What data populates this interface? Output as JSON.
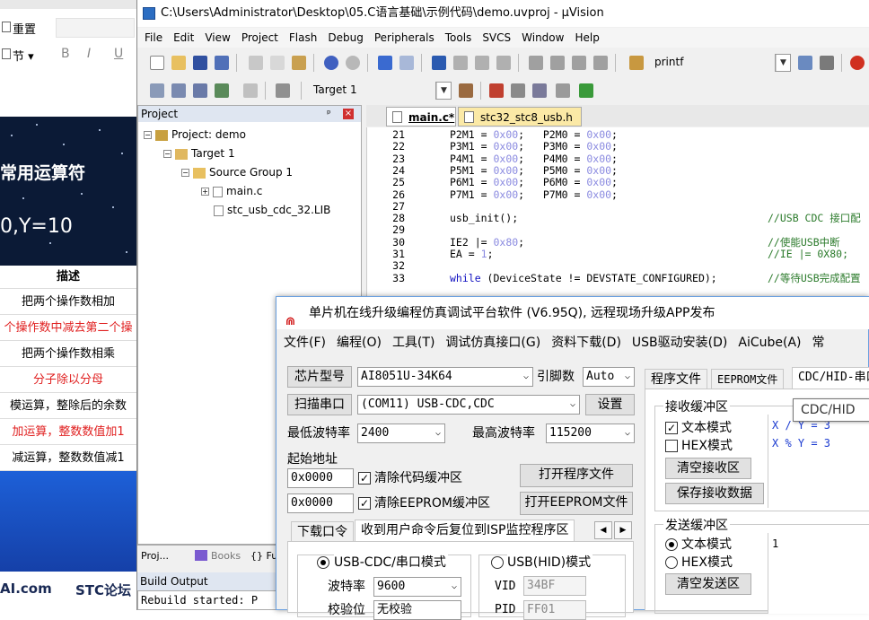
{
  "doc": {
    "toolbar_reset": "重置",
    "toolbar_section": "节 ▾",
    "toolbar_bold": "B",
    "toolbar_italic": "I",
    "toolbar_underline": "U",
    "title": "常用运算符",
    "formula": "0,Y=10",
    "table_header": "描述",
    "rows": [
      {
        "text": "把两个操作数相加",
        "red": false
      },
      {
        "text": "个操作数中减去第二个操",
        "red": true
      },
      {
        "text": "把两个操作数相乘",
        "red": false
      },
      {
        "text": "分子除以分母",
        "red": true
      },
      {
        "text": "模运算，整除后的余数",
        "red": false
      },
      {
        "text": "加运算，整数数值加1",
        "red": true
      },
      {
        "text": "减运算，整数数值减1",
        "red": false
      }
    ],
    "footer_left": "AI.com",
    "footer_right": "STC论坛"
  },
  "uv": {
    "title": "C:\\Users\\Administrator\\Desktop\\05.C语言基础\\示例代码\\demo.uvproj - µVision",
    "menu": [
      "File",
      "Edit",
      "View",
      "Project",
      "Flash",
      "Debug",
      "Peripherals",
      "Tools",
      "SVCS",
      "Window",
      "Help"
    ],
    "find_combo": "printf",
    "target_combo": "Target 1",
    "project_pane_title": "Project",
    "tree": {
      "project": "Project: demo",
      "target": "Target 1",
      "group": "Source Group 1",
      "file1": "main.c",
      "file2": "stc_usb_cdc_32.LIB"
    },
    "pane_tabs": [
      "Proj...",
      "Books",
      "{} Fu"
    ],
    "build_output_title": "Build Output",
    "build_text": "Rebuild started: P",
    "editor_tabs": [
      "main.c*",
      "stc32_stc8_usb.h"
    ],
    "code_lines": [
      {
        "n": "21",
        "code": "P2M1 = 0x00;   P2M0 = 0x00;",
        "comment": ""
      },
      {
        "n": "22",
        "code": "P3M1 = 0x00;   P3M0 = 0x00;",
        "comment": ""
      },
      {
        "n": "23",
        "code": "P4M1 = 0x00;   P4M0 = 0x00;",
        "comment": ""
      },
      {
        "n": "24",
        "code": "P5M1 = 0x00;   P5M0 = 0x00;",
        "comment": ""
      },
      {
        "n": "25",
        "code": "P6M1 = 0x00;   P6M0 = 0x00;",
        "comment": ""
      },
      {
        "n": "26",
        "code": "P7M1 = 0x00;   P7M0 = 0x00;",
        "comment": ""
      },
      {
        "n": "27",
        "code": "",
        "comment": ""
      },
      {
        "n": "28",
        "code": "usb_init();",
        "comment": "//USB CDC 接口配"
      },
      {
        "n": "29",
        "code": "",
        "comment": ""
      },
      {
        "n": "30",
        "code": "IE2 |= 0x80;",
        "comment": "//使能USB中断"
      },
      {
        "n": "31",
        "code": "EA = 1;",
        "comment": "//IE |= 0X80;"
      },
      {
        "n": "32",
        "code": "",
        "comment": ""
      },
      {
        "n": "33",
        "code": "while (DeviceState != DEVSTATE_CONFIGURED);",
        "comment": "//等待USB完成配置"
      }
    ]
  },
  "isp": {
    "title": "单片机在线升级编程仿真调试平台软件 (V6.95Q), 远程现场升级APP发布",
    "menu": [
      "文件(F)",
      "编程(O)",
      "工具(T)",
      "调试仿真接口(G)",
      "资料下载(D)",
      "USB驱动安装(D)",
      "AiCube(A)",
      "常"
    ],
    "chip_btn": "芯片型号",
    "chip_value": "AI8051U-34K64",
    "pin_label": "引脚数",
    "pin_value": "Auto",
    "scan_btn": "扫描串口",
    "port_value": "(COM11) USB-CDC,CDC",
    "settings_btn": "设置",
    "min_baud_label": "最低波特率",
    "min_baud": "2400",
    "max_baud_label": "最高波特率",
    "max_baud": "115200",
    "start_addr_label": "起始地址",
    "addr1": "0x0000",
    "clear_code": "清除代码缓冲区",
    "open_prog_btn": "打开程序文件",
    "addr2": "0x0000",
    "clear_eeprom": "清除EEPROM缓冲区",
    "open_eeprom_btn": "打开EEPROM文件",
    "tab_download": "下载口令",
    "tab_reset": "收到用户命令后复位到ISP监控程序区",
    "mode_cdc": "USB-CDC/串口模式",
    "mode_hid": "USB(HID)模式",
    "baud_label": "波特率",
    "baud_value": "9600",
    "vid_label": "VID",
    "vid_value": "34BF",
    "parity_label": "校验位",
    "parity_value": "无校验",
    "pid_label": "PID",
    "pid_value": "FF01",
    "right_tabs": [
      "程序文件",
      "EEPROM文件",
      "CDC/HID-串口"
    ],
    "tooltip": "CDC/HID",
    "recv_group": "接收缓冲区",
    "text_mode": "文本模式",
    "hex_mode": "HEX模式",
    "clear_recv_btn": "清空接收区",
    "save_recv_btn": "保存接收数据",
    "recv_lines": [
      "X / Y = 3",
      "X % Y = 3"
    ],
    "send_group": "发送缓冲区",
    "send_text_mode": "文本模式",
    "send_hex_mode": "HEX模式",
    "clear_send_btn": "清空发送区",
    "send_content": "1"
  }
}
